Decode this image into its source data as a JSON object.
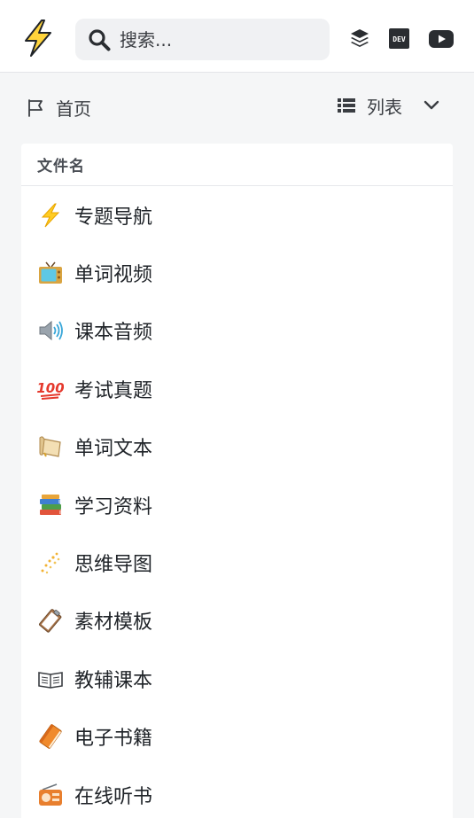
{
  "search": {
    "placeholder": "搜索..."
  },
  "header": {
    "icons": [
      "lightning-logo-icon",
      "search-icon",
      "layers-icon",
      "dev-icon",
      "youtube-icon"
    ]
  },
  "breadcrumb": {
    "home_label": "首页",
    "icon": "flag-icon"
  },
  "view_switch": {
    "label": "列表",
    "icon": "list-icon",
    "toggle_icon": "chevron-down-icon"
  },
  "file_list": {
    "column_header": "文件名",
    "items": [
      {
        "label": "专题导航",
        "icon": "high-voltage-icon"
      },
      {
        "label": "单词视频",
        "icon": "television-icon"
      },
      {
        "label": "课本音频",
        "icon": "speaker-icon"
      },
      {
        "label": "考试真题",
        "icon": "hundred-points-icon"
      },
      {
        "label": "单词文本",
        "icon": "scroll-icon"
      },
      {
        "label": "学习资料",
        "icon": "books-icon"
      },
      {
        "label": "思维导图",
        "icon": "sparkles-icon"
      },
      {
        "label": "素材模板",
        "icon": "clipboard-icon"
      },
      {
        "label": "教辅课本",
        "icon": "open-book-icon"
      },
      {
        "label": "电子书籍",
        "icon": "orange-book-icon"
      },
      {
        "label": "在线听书",
        "icon": "radio-icon"
      }
    ]
  },
  "colors": {
    "accent_yellow": "#ffd43b",
    "background": "#f5f6f7",
    "panel": "#ffffff"
  }
}
